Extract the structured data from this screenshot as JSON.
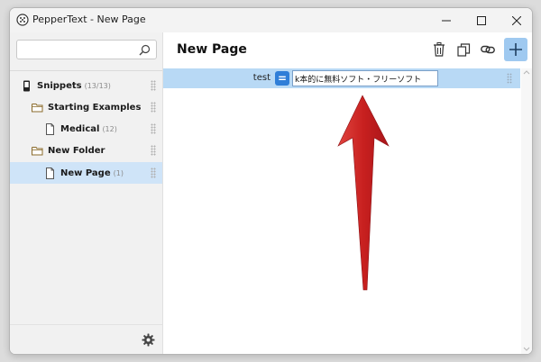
{
  "window": {
    "title": "PepperText - New Page"
  },
  "sidebar": {
    "search": {
      "value": "",
      "placeholder": ""
    },
    "items": [
      {
        "label": "Snippets",
        "count": "(13/13)"
      },
      {
        "label": "Starting Examples",
        "count": ""
      },
      {
        "label": "Medical",
        "count": "(12)"
      },
      {
        "label": "New Folder",
        "count": ""
      },
      {
        "label": "New Page",
        "count": "(1)"
      }
    ]
  },
  "main": {
    "title": "New Page",
    "row": {
      "key": "test",
      "operator": "=",
      "value": "k本的に無料ソフト・フリーソフト"
    }
  },
  "colors": {
    "accent": "#2f7ed8",
    "selected_row": "#b8d9f5",
    "selected_item": "#cfe4f8",
    "arrow": "#d3272b"
  }
}
